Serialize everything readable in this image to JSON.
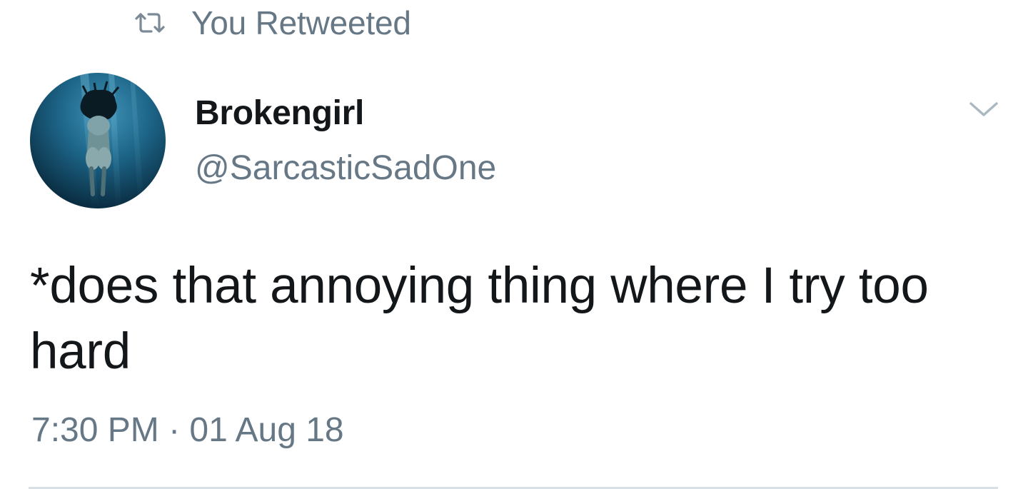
{
  "social_context": {
    "icon": "retweet-icon",
    "label": "You Retweeted"
  },
  "author": {
    "avatar": "avatar-underwater-figure",
    "display_name": "Brokengirl",
    "handle": "@SarcasticSadOne"
  },
  "menu": {
    "icon": "chevron-down-icon"
  },
  "tweet": {
    "text": "*does that annoying thing where I try too hard",
    "timestamp": "7:30 PM · 01 Aug 18"
  },
  "colors": {
    "text_primary": "#14171a",
    "text_secondary": "#667785",
    "icon_muted": "#aab8c2",
    "divider": "#d8dfe5"
  }
}
